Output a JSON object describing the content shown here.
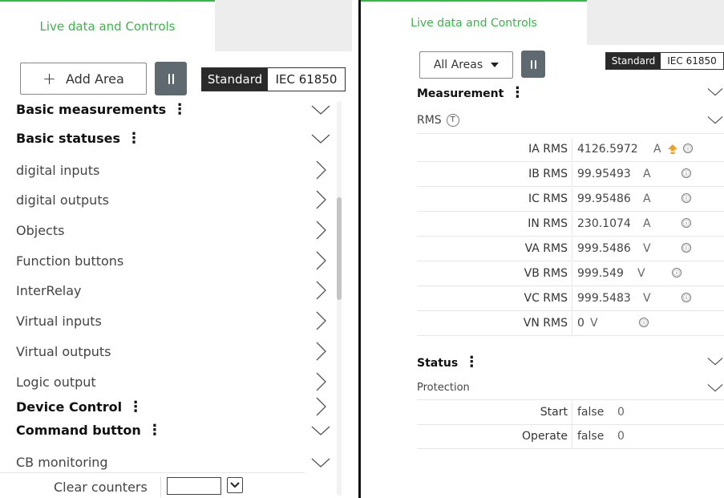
{
  "left": {
    "tab_label": "Live data and Controls",
    "add_area_label": "Add Area",
    "standard_label": "Standard",
    "iec_label": "IEC 61850",
    "rows": [
      {
        "label": "Basic measurements",
        "bold": true,
        "kebab": true,
        "chevron": "down"
      },
      {
        "label": "Basic statuses",
        "bold": true,
        "kebab": true,
        "chevron": "down"
      },
      {
        "label": "digital inputs",
        "bold": false,
        "chevron": "right"
      },
      {
        "label": "digital outputs",
        "bold": false,
        "chevron": "right"
      },
      {
        "label": "Objects",
        "bold": false,
        "chevron": "right"
      },
      {
        "label": "Function buttons",
        "bold": false,
        "chevron": "right"
      },
      {
        "label": "InterRelay",
        "bold": false,
        "chevron": "right"
      },
      {
        "label": "Virtual inputs",
        "bold": false,
        "chevron": "right"
      },
      {
        "label": "Virtual outputs",
        "bold": false,
        "chevron": "right"
      },
      {
        "label": "Logic output",
        "bold": false,
        "chevron": "right"
      },
      {
        "label": "Device Control",
        "bold": true,
        "kebab": true,
        "chevron": "right"
      },
      {
        "label": "Command button",
        "bold": true,
        "kebab": true,
        "chevron": "down"
      },
      {
        "label": "CB monitoring",
        "bold": false,
        "chevron": "down"
      }
    ],
    "clear_counters_label": "Clear counters",
    "clear_counters_value": ""
  },
  "right": {
    "tab_label": "Live data and Controls",
    "areas_select": "All Areas",
    "standard_label": "Standard",
    "iec_label": "IEC 61850",
    "measurement_header": "Measurement",
    "rms_label": "RMS",
    "rms_badge": "T",
    "measurements": [
      {
        "name": "IA RMS",
        "value": "4126.5972",
        "unit": "A",
        "warning": true
      },
      {
        "name": "IB RMS",
        "value": "99.95493",
        "unit": "A"
      },
      {
        "name": "IC RMS",
        "value": "99.95486",
        "unit": "A"
      },
      {
        "name": "IN RMS",
        "value": "230.1074",
        "unit": "A"
      },
      {
        "name": "VA RMS",
        "value": "999.5486",
        "unit": "V"
      },
      {
        "name": "VB RMS",
        "value": "999.549",
        "unit": "V"
      },
      {
        "name": "VC RMS",
        "value": "999.5483",
        "unit": "V"
      },
      {
        "name": "VN RMS",
        "value": "0",
        "unit": "V"
      }
    ],
    "status_header": "Status",
    "protection_label": "Protection",
    "statuses": [
      {
        "name": "Start",
        "value": "false",
        "count": "0"
      },
      {
        "name": "Operate",
        "value": "false",
        "count": "0"
      }
    ],
    "info_glyph": "ⓘ"
  },
  "colors": {
    "accent_green": "#3cb44b",
    "warning_orange": "#f0a020",
    "dark_segment": "#2a2a2a",
    "pause_button": "#5f6a70"
  }
}
